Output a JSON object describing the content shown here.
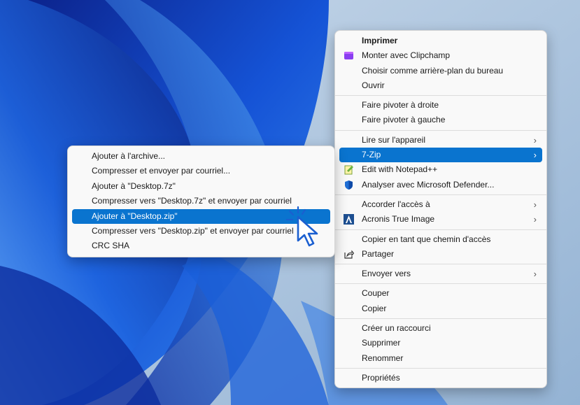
{
  "main_menu": {
    "groups": [
      [
        {
          "label": "Imprimer",
          "bold": true
        },
        {
          "label": "Monter avec Clipchamp",
          "icon": "clipchamp-icon"
        },
        {
          "label": "Choisir comme arrière-plan du bureau"
        },
        {
          "label": "Ouvrir"
        }
      ],
      [
        {
          "label": "Faire pivoter à droite"
        },
        {
          "label": "Faire pivoter à gauche"
        }
      ],
      [
        {
          "label": "Lire sur l'appareil",
          "submenu": true
        },
        {
          "label": "7-Zip",
          "submenu": true,
          "selected": true
        },
        {
          "label": "Edit with Notepad++",
          "icon": "notepad-plus-plus-icon"
        },
        {
          "label": "Analyser avec Microsoft Defender...",
          "icon": "defender-shield-icon"
        }
      ],
      [
        {
          "label": "Accorder l'accès à",
          "submenu": true
        },
        {
          "label": "Acronis True Image",
          "submenu": true,
          "icon": "acronis-icon"
        }
      ],
      [
        {
          "label": "Copier en tant que chemin d'accès"
        },
        {
          "label": "Partager",
          "icon": "share-icon"
        }
      ],
      [
        {
          "label": "Envoyer vers",
          "submenu": true
        }
      ],
      [
        {
          "label": "Couper"
        },
        {
          "label": "Copier"
        }
      ],
      [
        {
          "label": "Créer un raccourci"
        },
        {
          "label": "Supprimer"
        },
        {
          "label": "Renommer"
        }
      ],
      [
        {
          "label": "Propriétés"
        }
      ]
    ]
  },
  "sub_menu": {
    "items": [
      {
        "label": "Ajouter à l'archive..."
      },
      {
        "label": "Compresser et envoyer par courriel..."
      },
      {
        "label": "Ajouter à \"Desktop.7z\""
      },
      {
        "label": "Compresser vers \"Desktop.7z\" et envoyer par courriel"
      },
      {
        "label": "Ajouter à \"Desktop.zip\"",
        "selected": true
      },
      {
        "label": "Compresser vers \"Desktop.zip\" et envoyer par courriel"
      },
      {
        "label": "CRC SHA"
      }
    ]
  },
  "colors": {
    "selection": "#0a74cf",
    "menu_bg": "#f9f9f9",
    "wallpaper_deep": "#0b2a9a",
    "wallpaper_light": "#5aa8f0"
  }
}
